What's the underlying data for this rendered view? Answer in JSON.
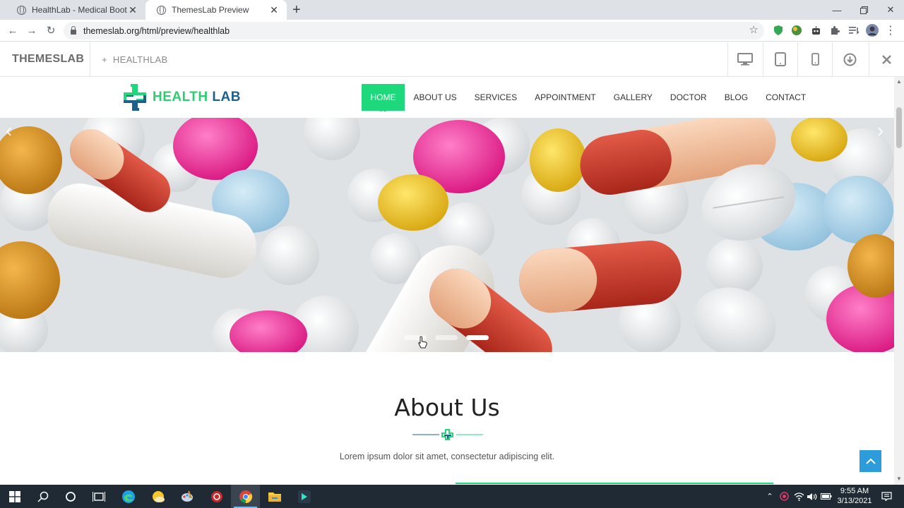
{
  "browser": {
    "tabs": [
      {
        "title": "HealthLab - Medical Bootstrap H",
        "active": false
      },
      {
        "title": "ThemesLab Preview",
        "active": true
      }
    ],
    "url": "themeslab.org/html/preview/healthlab"
  },
  "preview_bar": {
    "brand": "THEMESLAB",
    "project": "HEALTHLAB",
    "devices": [
      "desktop-icon",
      "tablet-icon",
      "mobile-icon",
      "download-icon",
      "close-icon"
    ]
  },
  "site": {
    "logo": {
      "part1": "HEALTH",
      "part2": "LAB"
    },
    "menu": [
      "HOME",
      "ABOUT US",
      "SERVICES",
      "APPOINTMENT",
      "GALLERY",
      "DOCTOR",
      "BLOG",
      "CONTACT"
    ],
    "active_menu": "HOME",
    "slider": {
      "slides": 3,
      "active_slide": 3
    },
    "about": {
      "title": "About Us",
      "text": "Lorem ipsum dolor sit amet, consectetur adipiscing elit."
    }
  },
  "taskbar": {
    "time": "9:55 AM",
    "date": "3/13/2021"
  },
  "colors": {
    "accent_green": "#1dd97c",
    "logo_blue": "#1f5f8b",
    "totop_blue": "#2d9cdb",
    "taskbar": "#1f2a35"
  }
}
